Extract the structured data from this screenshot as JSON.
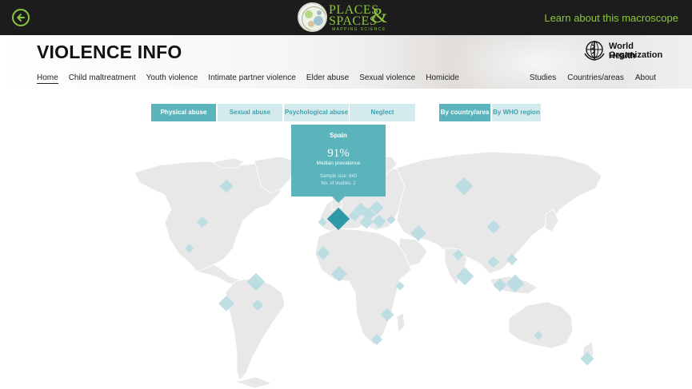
{
  "topbar": {
    "back_icon": "back-arrow-icon",
    "logo": {
      "line1": "PLACES",
      "amp": "&",
      "line2": "SPACES",
      "subtitle": "MAPPING SCIENCE"
    },
    "learn_link": "Learn about this macroscope",
    "accent_color": "#8cc63f"
  },
  "header": {
    "title": "VIOLENCE INFO",
    "who": {
      "line1": "World Health",
      "line2": "Organization"
    },
    "nav_left": [
      "Home",
      "Child maltreatment",
      "Youth violence",
      "Intimate partner violence",
      "Elder abuse",
      "Sexual violence",
      "Homicide"
    ],
    "nav_right": [
      "Studies",
      "Countries/areas",
      "About"
    ],
    "active_nav": "Home"
  },
  "tabs": {
    "violence_types": [
      "Physical abuse",
      "Sexual abuse",
      "Psychological abuse",
      "Neglect"
    ],
    "active_type": "Physical abuse",
    "groupings": [
      "By country/area",
      "By WHO region"
    ],
    "active_grouping": "By country/area",
    "colors": {
      "active": "#5bb3bb",
      "inactive": "#d4ebee",
      "inactive_text": "#3ea3ad"
    }
  },
  "tooltip": {
    "country": "Spain",
    "value": "91%",
    "value_label": "Median prevalence",
    "sample": "Sample size: 640",
    "studies": "No. of studies: 2"
  },
  "map_colors": {
    "land": "#e8e8e8",
    "marker": "#b8dde2",
    "highlight": "#2e9aa5"
  }
}
